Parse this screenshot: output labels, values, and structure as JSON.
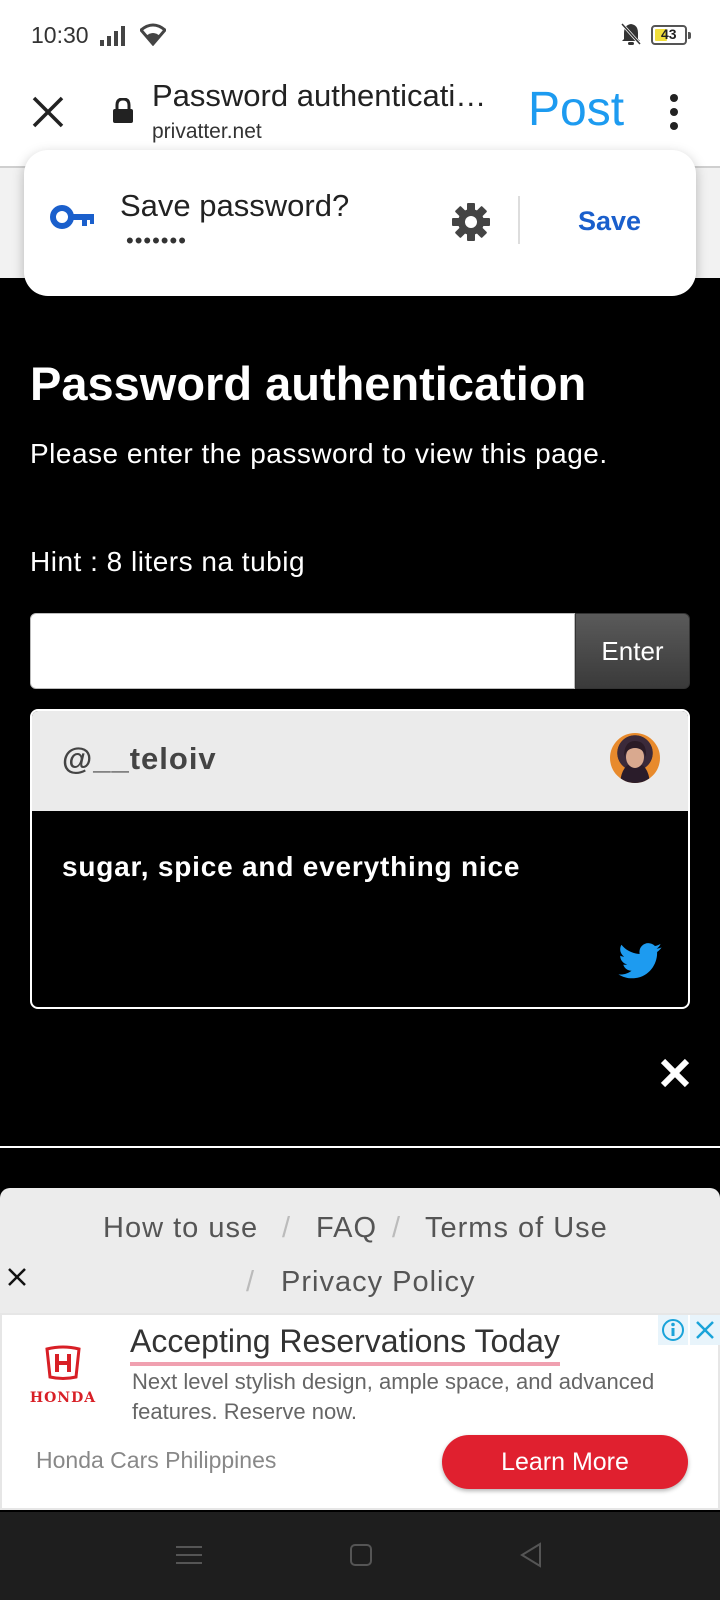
{
  "status_bar": {
    "time": "10:30",
    "battery": "43"
  },
  "browser": {
    "page_title": "Password authenticati…",
    "url": "privatter.net",
    "post_label": "Post"
  },
  "save_password": {
    "title": "Save password?",
    "masked": "•••••••",
    "save_label": "Save"
  },
  "page": {
    "heading": "Password authentication",
    "instruction": "Please enter the password to view this page.",
    "hint": "Hint : 8 liters na tubig",
    "password_value": "",
    "enter_label": "Enter"
  },
  "profile_card": {
    "handle": "@__teloiv",
    "bio": "sugar, spice and everything nice"
  },
  "footer": {
    "links": [
      "How to use",
      "FAQ",
      "Terms of Use",
      "Privacy Policy"
    ],
    "separator": "/"
  },
  "ad": {
    "brand": "HONDA",
    "headline": "Accepting Reservations Today",
    "description": "Next level stylish design, ample space, and advanced features. Reserve now.",
    "advertiser": "Honda Cars Philippines",
    "cta": "Learn More"
  },
  "colors": {
    "accent_blue": "#1d9bf0",
    "save_blue": "#1a5fcc",
    "ad_red": "#e0202f"
  }
}
